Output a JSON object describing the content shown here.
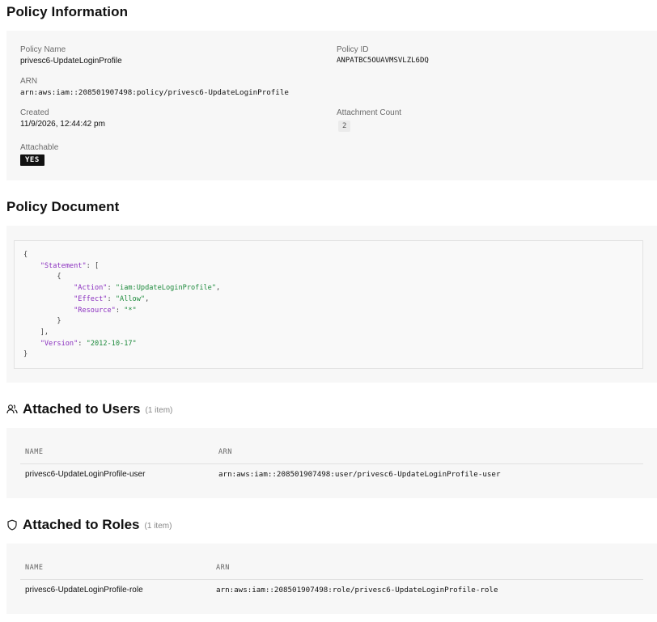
{
  "policy_info": {
    "title": "Policy Information",
    "name_label": "Policy Name",
    "name_value": "privesc6-UpdateLoginProfile",
    "id_label": "Policy ID",
    "id_value": "ANPATBC5OUAVMSVLZL6DQ",
    "arn_label": "ARN",
    "arn_value": "arn:aws:iam::208501907498:policy/privesc6-UpdateLoginProfile",
    "created_label": "Created",
    "created_value": "11/9/2026, 12:44:42 pm",
    "attachment_label": "Attachment Count",
    "attachment_value": "2",
    "attachable_label": "Attachable",
    "attachable_value": "YES"
  },
  "policy_document": {
    "title": "Policy Document",
    "lines": [
      {
        "p": "{",
        "k": "",
        "m": "",
        "v": "",
        "e": ""
      },
      {
        "p": "    ",
        "k": "\"Statement\"",
        "m": ": [",
        "v": "",
        "e": ""
      },
      {
        "p": "        {",
        "k": "",
        "m": "",
        "v": "",
        "e": ""
      },
      {
        "p": "            ",
        "k": "\"Action\"",
        "m": ": ",
        "v": "\"iam:UpdateLoginProfile\"",
        "e": ","
      },
      {
        "p": "            ",
        "k": "\"Effect\"",
        "m": ": ",
        "v": "\"Allow\"",
        "e": ","
      },
      {
        "p": "            ",
        "k": "\"Resource\"",
        "m": ": ",
        "v": "\"*\"",
        "e": ""
      },
      {
        "p": "        }",
        "k": "",
        "m": "",
        "v": "",
        "e": ""
      },
      {
        "p": "    ],",
        "k": "",
        "m": "",
        "v": "",
        "e": ""
      },
      {
        "p": "    ",
        "k": "\"Version\"",
        "m": ": ",
        "v": "\"2012-10-17\"",
        "e": ""
      },
      {
        "p": "}",
        "k": "",
        "m": "",
        "v": "",
        "e": ""
      }
    ]
  },
  "users": {
    "title": "Attached to Users",
    "count": "(1 item)",
    "col_name": "NAME",
    "col_arn": "ARN",
    "rows": [
      {
        "name": "privesc6-UpdateLoginProfile-user",
        "arn": "arn:aws:iam::208501907498:user/privesc6-UpdateLoginProfile-user"
      }
    ]
  },
  "roles": {
    "title": "Attached to Roles",
    "count": "(1 item)",
    "col_name": "NAME",
    "col_arn": "ARN",
    "rows": [
      {
        "name": "privesc6-UpdateLoginProfile-role",
        "arn": "arn:aws:iam::208501907498:role/privesc6-UpdateLoginProfile-role"
      }
    ]
  }
}
